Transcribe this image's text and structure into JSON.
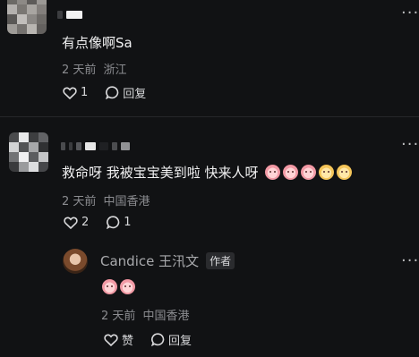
{
  "comments": [
    {
      "text": "有点像啊Sa",
      "time": "2 天前",
      "location": "浙江",
      "likes": "1",
      "reply_label": "回复"
    },
    {
      "text": "救命呀 我被宝宝美到啦 快来人呀",
      "emojis": [
        "pink",
        "pink",
        "pink",
        "yellow",
        "yellow"
      ],
      "time": "2 天前",
      "location": "中国香港",
      "likes": "2",
      "replies": "1"
    }
  ],
  "reply": {
    "author": "Candice 王汛文",
    "author_tag": "作者",
    "emojis": [
      "pink",
      "pink"
    ],
    "time": "2 天前",
    "location": "中国香港",
    "like_label": "赞",
    "reply_label": "回复"
  },
  "icons": {
    "more": "more-dots-icon",
    "heart": "heart-icon",
    "reply": "speech-bubble-icon"
  }
}
